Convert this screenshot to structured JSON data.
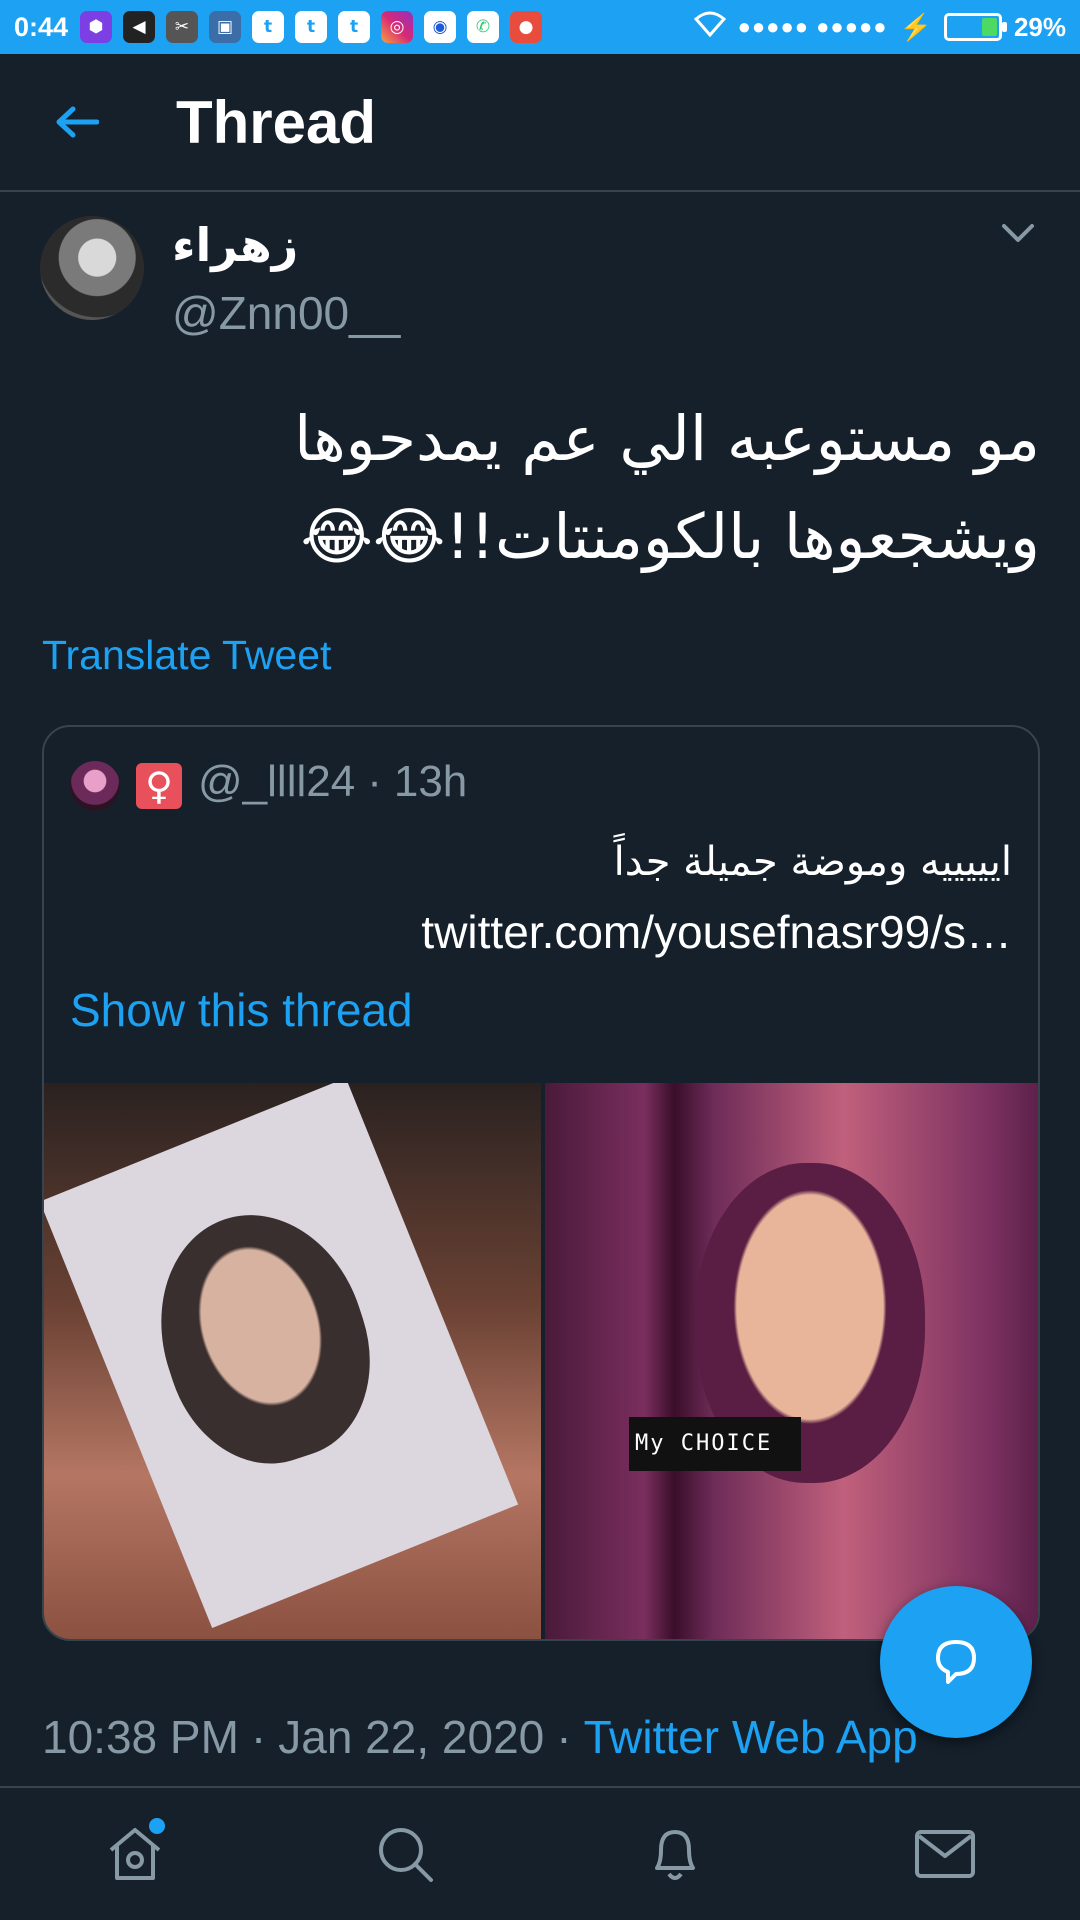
{
  "status_bar": {
    "time": "0:44",
    "battery": "29%",
    "battery_level": 0.29,
    "signal": "●●●●● ●●●●●",
    "icons": [
      "shield-icon",
      "volume-icon",
      "scissors-icon",
      "film-icon",
      "twitter-icon",
      "twitter-icon",
      "twitter-icon",
      "instagram-icon",
      "camera-icon",
      "phone-icon",
      "app-icon"
    ],
    "accent": "#1da1f2"
  },
  "header": {
    "title": "Thread"
  },
  "tweet": {
    "name": "زهراء",
    "handle": "@Znn00__",
    "text": "مو مستوعبه الي عم يمدحوها\nويشجعوها بالكومنتات!!😂😂",
    "translate_label": "Translate Tweet",
    "timestamp": "10:38 PM",
    "date": "Jan 22, 2020",
    "source": "Twitter Web App"
  },
  "quoted": {
    "badge": "♀",
    "handle": "@_llll24",
    "time": "13h",
    "text": "ايييييه وموضة جميلة جداً",
    "link": "twitter.com/yousefnasr99/s…",
    "show_thread": "Show this thread",
    "photo_caption": "My CHOICE"
  },
  "nav": [
    "home-icon",
    "search-icon",
    "notifications-icon",
    "messages-icon"
  ],
  "colors": {
    "background": "#15202b",
    "link": "#1da1f2",
    "muted": "#8899a6",
    "border": "#38444d"
  }
}
